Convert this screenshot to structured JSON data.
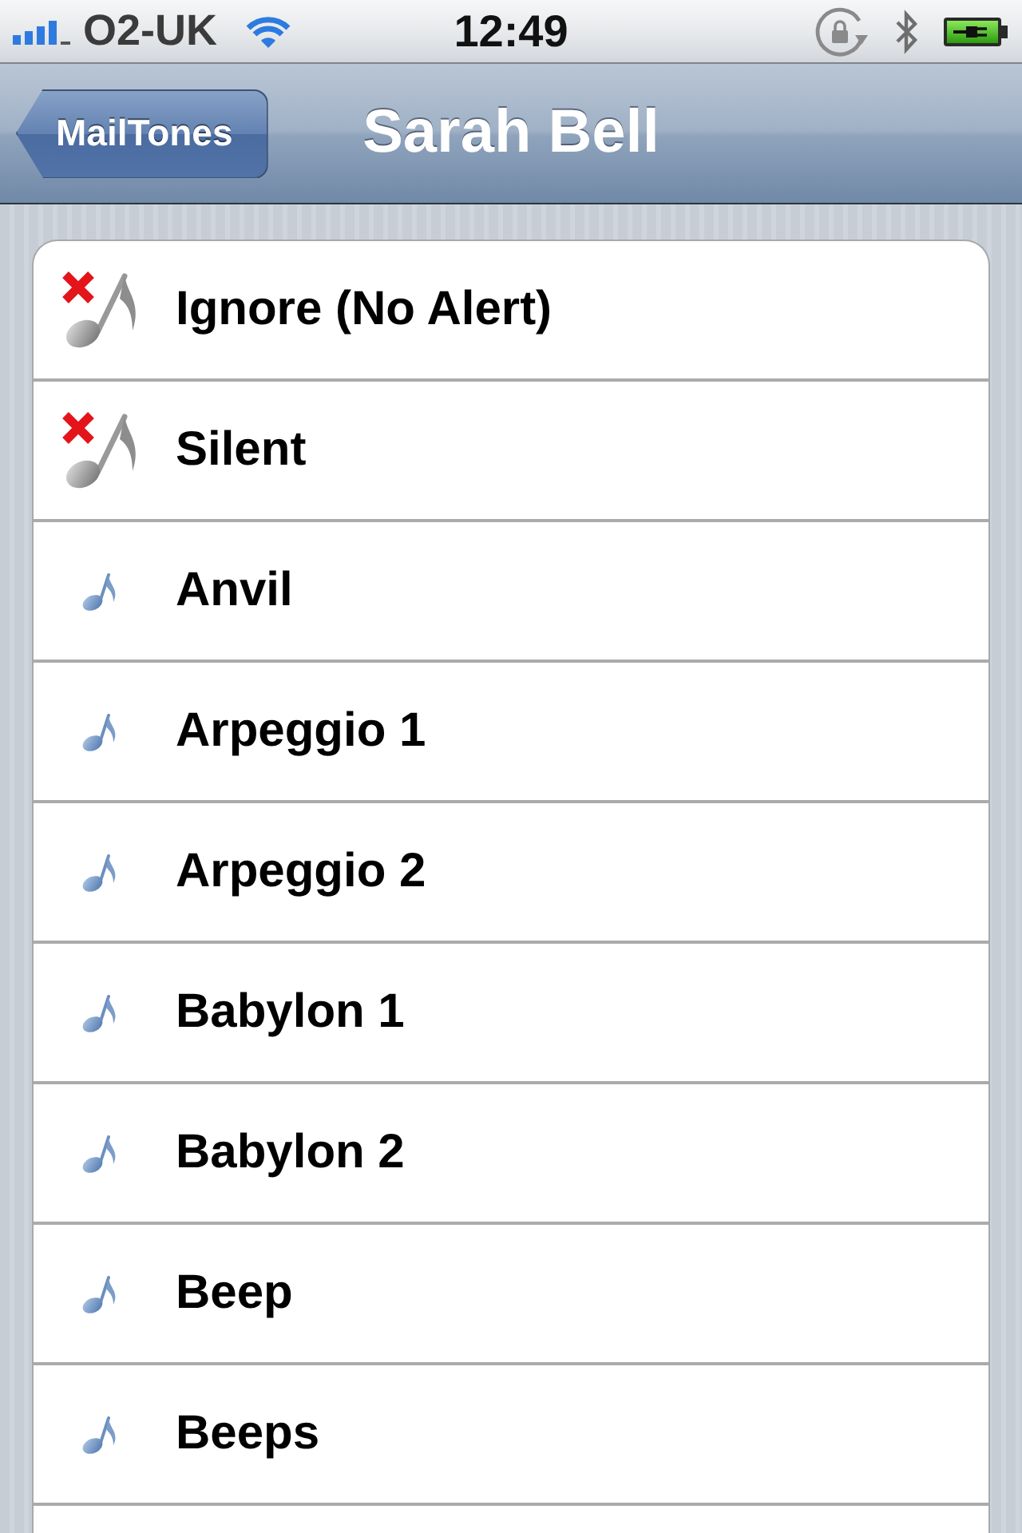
{
  "status_bar": {
    "carrier": "O2-UK",
    "time": "12:49"
  },
  "nav_bar": {
    "back_button": "MailTones",
    "title": "Sarah Bell"
  },
  "tones": [
    {
      "kind": "no_alert",
      "label": "Ignore (No Alert)"
    },
    {
      "kind": "no_alert",
      "label": "Silent"
    },
    {
      "kind": "tone",
      "label": "Anvil"
    },
    {
      "kind": "tone",
      "label": "Arpeggio 1"
    },
    {
      "kind": "tone",
      "label": "Arpeggio 2"
    },
    {
      "kind": "tone",
      "label": "Babylon 1"
    },
    {
      "kind": "tone",
      "label": "Babylon 2"
    },
    {
      "kind": "tone",
      "label": "Beep"
    },
    {
      "kind": "tone",
      "label": "Beeps"
    }
  ]
}
